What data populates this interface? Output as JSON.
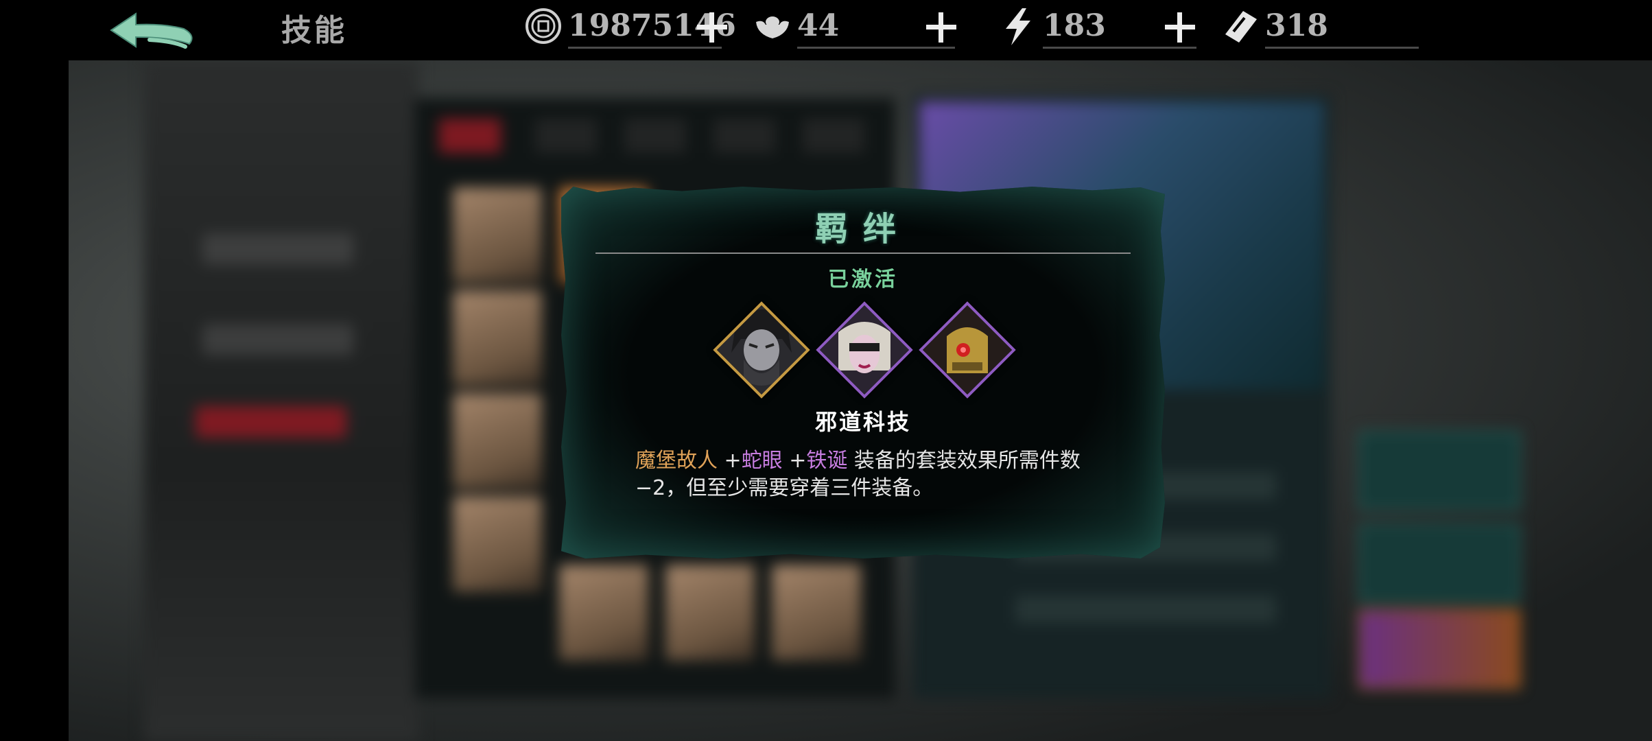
{
  "header": {
    "title": "技能",
    "resources": [
      {
        "icon": "coin-icon",
        "value": "19875146"
      },
      {
        "icon": "silver-ingot-icon",
        "value": "44"
      },
      {
        "icon": "lightning-icon",
        "value": "183"
      },
      {
        "icon": "ticket-icon",
        "value": "318"
      }
    ]
  },
  "modal": {
    "title": "羁绊",
    "status": "已激活",
    "portraits": [
      {
        "name": "bearded-warrior-portrait",
        "frame": "gold"
      },
      {
        "name": "masked-lady-portrait",
        "frame": "purple"
      },
      {
        "name": "golden-mech-portrait",
        "frame": "purple"
      }
    ],
    "set_name": "邪道科技",
    "desc": {
      "part1": "魔堡故人",
      "sep1": " +",
      "part2": "蛇眼",
      "sep2": " +",
      "part3": "铁诞",
      "rest": " 装备的套装效果所需件数−2，但至少需要穿着三件装备。"
    }
  },
  "colors": {
    "title_green": "#8fd0b4",
    "status_green": "#79d19c",
    "gold_text": "#e0a258",
    "violet_text": "#c77de0",
    "gold_frame": "#c59a42",
    "purple_frame": "#8e5bc2"
  }
}
